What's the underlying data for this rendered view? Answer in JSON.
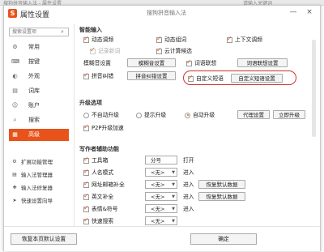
{
  "background": {
    "left_text": "搜狗拼音输入法 - 属性设置",
    "right_text": "请输入关键词"
  },
  "window": {
    "app_title": "属性设置",
    "caption": "搜狗拼音输入法",
    "logo_glyph": "S",
    "min_glyph": "—",
    "close_glyph": "×"
  },
  "sidebar": {
    "search_placeholder": "搜索设置项",
    "items": [
      {
        "label": "常用",
        "icon": "gear-icon",
        "glyph": "⚙"
      },
      {
        "label": "按键",
        "icon": "keyboard-icon",
        "glyph": "⌨"
      },
      {
        "label": "外观",
        "icon": "palette-icon",
        "glyph": "◐"
      },
      {
        "label": "词库",
        "icon": "book-icon",
        "glyph": "▤"
      },
      {
        "label": "账户",
        "icon": "user-icon",
        "glyph": "☺"
      },
      {
        "label": "搜索",
        "icon": "search-icon",
        "glyph": "⌕"
      },
      {
        "label": "高级",
        "icon": "advanced-icon",
        "glyph": "▦"
      }
    ],
    "tools": [
      {
        "label": "扩展功能管理",
        "icon": "extension-icon",
        "glyph": "⚙"
      },
      {
        "label": "输入法管理器",
        "icon": "manager-icon",
        "glyph": "▤"
      },
      {
        "label": "输入法修复器",
        "icon": "repair-icon",
        "glyph": "✚"
      },
      {
        "label": "快速设置向导",
        "icon": "wizard-icon",
        "glyph": "➤"
      }
    ]
  },
  "smart_input": {
    "section_title": "智能输入",
    "dynamic_freq": "动态调频",
    "dynamic_combo": "动态组词",
    "context_freq": "上下文调频",
    "memory_new": "记录新词",
    "cloud_candidate": "云计算候选",
    "fuzzy_label": "模糊音设置",
    "fuzzy_button": "模糊音设置",
    "word_assoc": "词语联想",
    "word_assoc_button": "词语联想设置",
    "pinyin_correct": "拼音纠错",
    "pinyin_correct_button": "拼音纠错设置",
    "custom_phrase": "自定义短语",
    "custom_phrase_button": "自定义短语设置"
  },
  "upgrade": {
    "section_title": "升级选项",
    "no_auto": "不自动升级",
    "prompt": "提示升级",
    "auto": "自动升级",
    "proxy_button": "代理设置",
    "now_button": "立即升级",
    "p2p": "P2P升级加速"
  },
  "writing": {
    "section_title": "写作者辅助功能",
    "enter_label": "进入",
    "open_label": "打开",
    "restore_button": "恢复默认数据",
    "rows": [
      {
        "label": "工具箱",
        "key": "分号",
        "action": "打开",
        "has_restore": false
      },
      {
        "label": "人名模式",
        "key": "<无>",
        "action": "进入",
        "has_restore": false
      },
      {
        "label": "网址邮箱补全",
        "key": "<无>",
        "action": "进入",
        "has_restore": true
      },
      {
        "label": "英文补全",
        "key": "<无>",
        "action": "进入",
        "has_restore": true
      },
      {
        "label": "表情&符号",
        "key": "<无>",
        "action": "进入",
        "has_restore": false
      },
      {
        "label": "快速搜索",
        "key": "<无>",
        "action": "",
        "has_restore": false
      }
    ]
  },
  "footer": {
    "restore_page_button": "恢复本页默认设置",
    "ok_button": "确定"
  },
  "colors": {
    "accent": "#e8531b",
    "highlight": "#d2302c"
  }
}
